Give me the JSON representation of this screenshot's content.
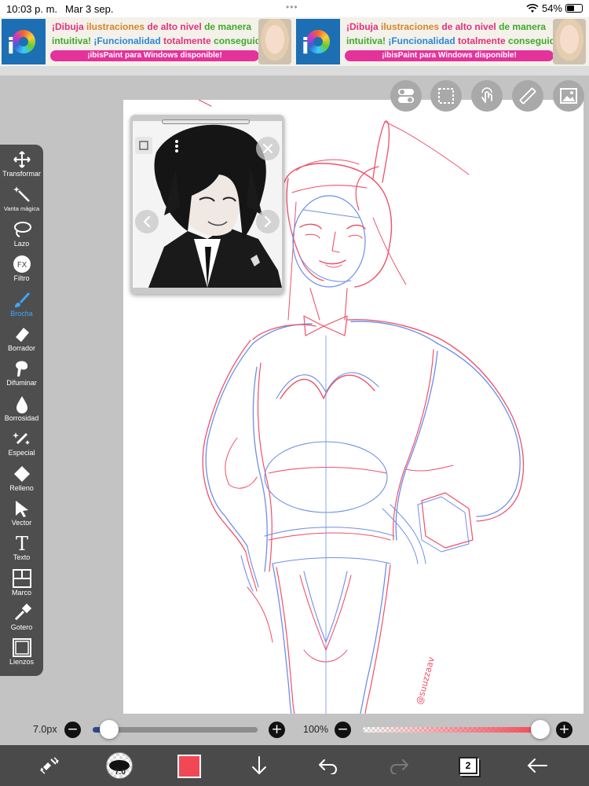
{
  "status_bar": {
    "time": "10:03 p. m.",
    "date": "Mar 3 sep.",
    "battery": "54%",
    "battery_level": 0.54
  },
  "ad_banner": {
    "ads": [
      {
        "line1_parts": [
          "¡Dibuja",
          " ilustraciones",
          " de alto nivel",
          " de manera"
        ],
        "line2_parts": [
          "intuitiva!",
          " ¡Funcionalidad",
          " totalmente",
          " conseguida!"
        ],
        "pill": "¡ibisPaint para Windows disponible!"
      },
      {
        "line1_parts": [
          "¡Dibuja",
          " ilustraciones",
          " de alto nivel",
          " de manera"
        ],
        "line2_parts": [
          "intuitiva!",
          " ¡Funcionalidad",
          " totalmente",
          " conseguida!"
        ],
        "pill": "¡ibisPaint para Windows disponible!"
      }
    ],
    "line1_colors": [
      "#e0327a",
      "#d6852a",
      "#e0327a",
      "#43a82c"
    ],
    "line2_colors": [
      "#43a82c",
      "#2d86d6",
      "#e0327a",
      "#43a82c"
    ]
  },
  "top_tools": [
    {
      "name": "toggle-icon"
    },
    {
      "name": "selection-icon"
    },
    {
      "name": "touch-icon"
    },
    {
      "name": "ruler-icon"
    },
    {
      "name": "reference-image-icon"
    }
  ],
  "toolbar": {
    "items": [
      {
        "label": "Transformar",
        "icon": "transform-icon"
      },
      {
        "label": "Varita mágica",
        "icon": "magic-wand-icon",
        "small": true
      },
      {
        "label": "Lazo",
        "icon": "lasso-icon"
      },
      {
        "label": "Filtro",
        "icon": "filter-icon"
      },
      {
        "label": "Brocha",
        "icon": "brush-icon",
        "active": true
      },
      {
        "label": "Borrador",
        "icon": "eraser-icon"
      },
      {
        "label": "Difuminar",
        "icon": "blur-icon"
      },
      {
        "label": "Borrosidad",
        "icon": "blur-drop-icon"
      },
      {
        "label": "Especial",
        "icon": "special-icon"
      },
      {
        "label": "Relleno",
        "icon": "fill-icon"
      },
      {
        "label": "Vector",
        "icon": "vector-icon"
      },
      {
        "label": "Texto",
        "icon": "text-icon"
      },
      {
        "label": "Marco",
        "icon": "frame-icon"
      },
      {
        "label": "Gotero",
        "icon": "eyedropper-icon"
      },
      {
        "label": "Lienzos",
        "icon": "canvas-icon"
      }
    ]
  },
  "brush_size": {
    "label": "7.0px",
    "minus": "−",
    "plus": "+",
    "level": 0.1
  },
  "opacity": {
    "label": "100%",
    "minus": "−",
    "plus": "+",
    "level": 1.0
  },
  "bottom_bar": {
    "brush_size_label": "7.0",
    "color": "#f24856",
    "layer_count": "2"
  },
  "colors": {
    "sketch_red": "#f0506a",
    "sketch_blue": "#6d8fe8",
    "accent_blue": "#3ea6ff"
  },
  "signature": "@suuzzaav"
}
